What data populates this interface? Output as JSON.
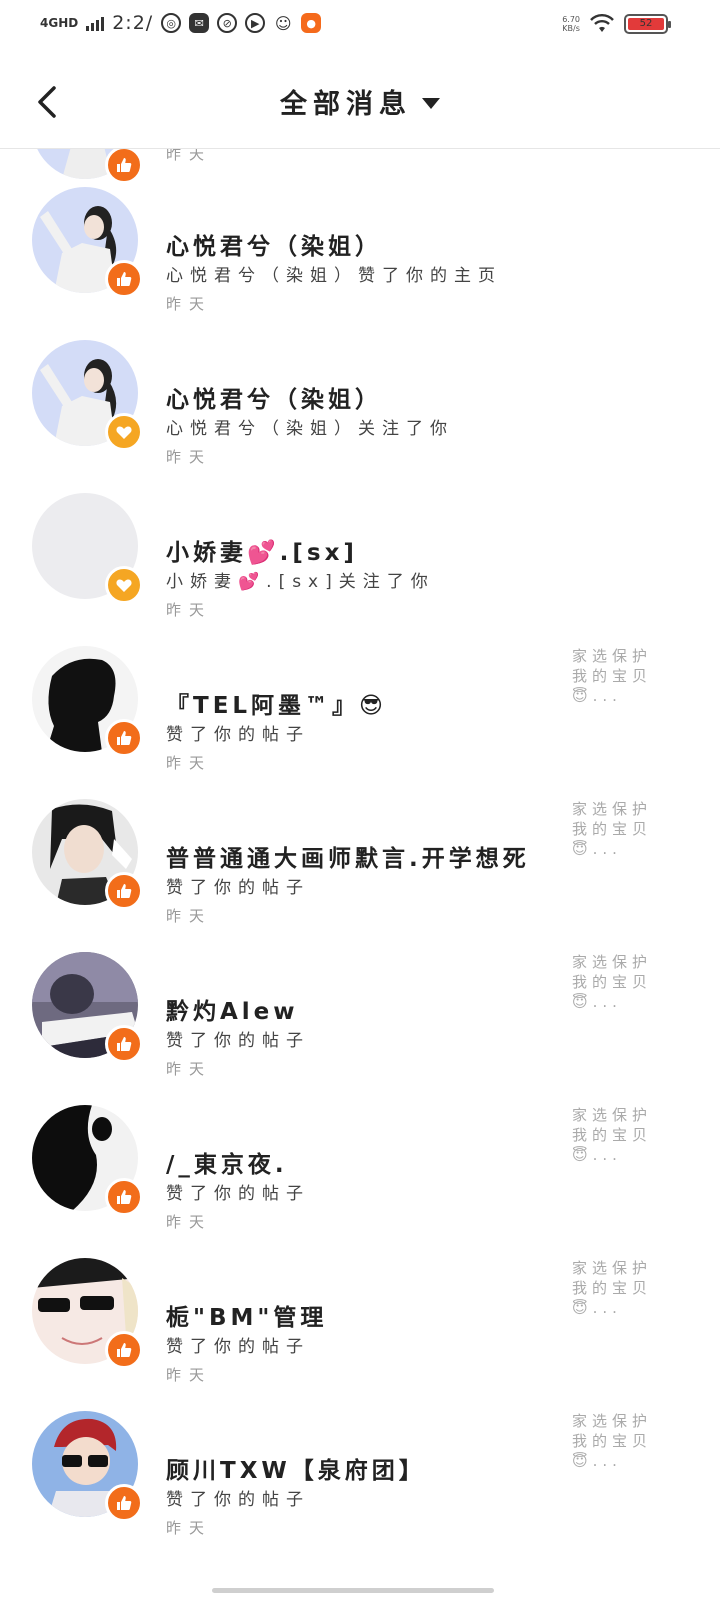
{
  "status_bar": {
    "network": "4GHD",
    "time": "2:2/",
    "speed_value": "6.70",
    "speed_unit": "KB/s",
    "battery": "52"
  },
  "header": {
    "back_icon": "chevron-left-icon",
    "title": "全部消息",
    "dropdown_icon": "caret-down-icon"
  },
  "partial_item": {
    "time": "昨天",
    "badge": "like"
  },
  "items": [
    {
      "name": "心悦君兮（染姐）",
      "action": "心悦君兮（染姐）赞了你的主页",
      "time": "昨天",
      "badge": "like",
      "avatar": "anime-girl-white",
      "ref": ""
    },
    {
      "name": "心悦君兮（染姐）",
      "action": "心悦君兮（染姐）关注了你",
      "time": "昨天",
      "badge": "heart",
      "avatar": "anime-girl-white",
      "ref": ""
    },
    {
      "name": "小娇妻💕.[sx]",
      "action": "小娇妻💕.[sx]关注了你",
      "time": "昨天",
      "badge": "heart",
      "avatar": "blank",
      "ref": ""
    },
    {
      "name": "『TEL阿墨™』😎",
      "action": "赞了你的帖子",
      "time": "昨天",
      "badge": "like",
      "avatar": "silhouette",
      "ref": "家选保护我的宝贝😇..."
    },
    {
      "name": "普普通通大画师默言.开学想死",
      "action": "赞了你的帖子",
      "time": "昨天",
      "badge": "like",
      "avatar": "anime-boy-dark",
      "ref": "家选保护我的宝贝😇..."
    },
    {
      "name": "黔灼Alew",
      "action": "赞了你的帖子",
      "time": "昨天",
      "badge": "like",
      "avatar": "piano",
      "ref": "家选保护我的宝贝😇..."
    },
    {
      "name": "/_東京夜.",
      "action": "赞了你的帖子",
      "time": "昨天",
      "badge": "like",
      "avatar": "dark-figure",
      "ref": "家选保护我的宝贝😇..."
    },
    {
      "name": "栀\"BM\"管理",
      "action": "赞了你的帖子",
      "time": "昨天",
      "badge": "like",
      "avatar": "sunglasses-face",
      "ref": "家选保护我的宝贝😇..."
    },
    {
      "name": "顾川TXW【泉府团】",
      "action": "赞了你的帖子",
      "time": "昨天",
      "badge": "like",
      "avatar": "red-hair-boy",
      "ref": "家选保护我的宝贝😇..."
    }
  ],
  "colors": {
    "like_badge": "#f26d1a",
    "heart_badge": "#f5a623"
  }
}
